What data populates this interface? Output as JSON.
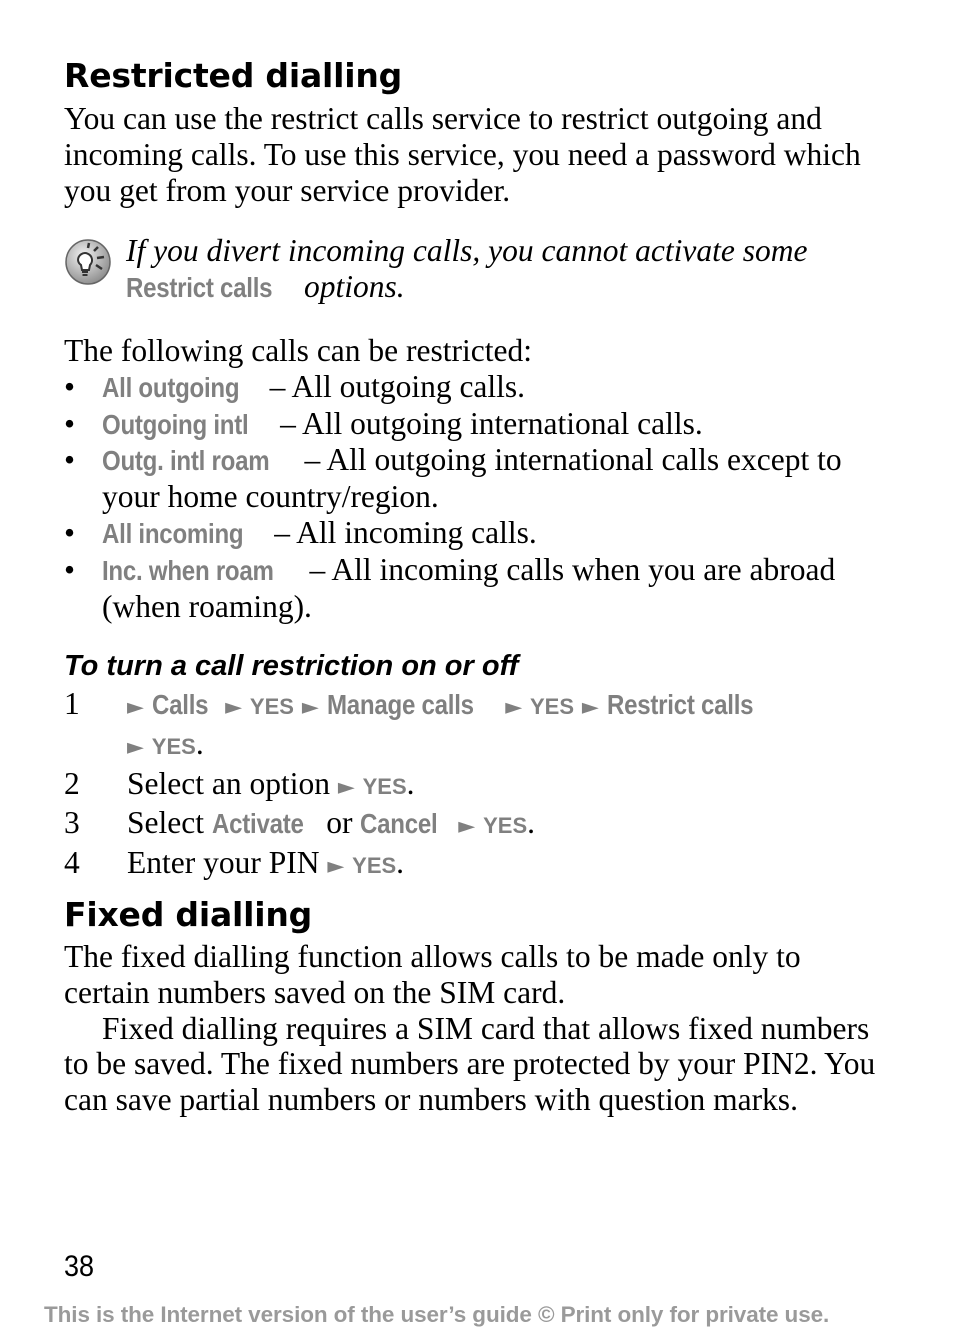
{
  "sections": {
    "restricted": {
      "title": "Restricted dialling",
      "intro": "You can use the restrict calls service to restrict outgoing and incoming calls. To use this service, you need a password which you get from your service provider.",
      "note": {
        "icon": "lightbulb-tip-icon",
        "text_before": "If you divert incoming calls, you cannot activate some",
        "ui_term": "Restrict calls",
        "text_after": "options."
      },
      "list_intro": "The following calls can be restricted:",
      "items": [
        {
          "term": "All outgoing",
          "desc": "– All outgoing calls."
        },
        {
          "term": "Outgoing intl",
          "desc": "– All outgoing international calls."
        },
        {
          "term": "Outg. intl roam",
          "desc": "– All outgoing international calls except to your home country/region."
        },
        {
          "term": "All incoming",
          "desc": "– All incoming calls."
        },
        {
          "term": "Inc. when roam",
          "desc": "– All incoming calls when you are abroad (when roaming)."
        }
      ],
      "procedure": {
        "title": "To turn a call restriction on or off",
        "steps": [
          {
            "num": "1",
            "menu1": "Calls",
            "yes1": "YES",
            "menu2": "Manage calls",
            "yes2": "YES",
            "menu3": "Restrict calls",
            "yes3": "YES"
          },
          {
            "num": "2",
            "text": "Select an option",
            "yes": "YES"
          },
          {
            "num": "3",
            "text": "Select",
            "opt1": "Activate",
            "or": "or",
            "opt2": "Cancel",
            "yes": "YES"
          },
          {
            "num": "4",
            "text": "Enter your PIN",
            "yes": "YES"
          }
        ]
      }
    },
    "fixed": {
      "title": "Fixed dialling",
      "para1": "The fixed dialling function allows calls to be made only to certain numbers saved on the SIM card.",
      "para2": "Fixed dialling requires a SIM card that allows fixed numbers to be saved. The fixed numbers are protected by your PIN2. You can save partial numbers or numbers with question marks."
    }
  },
  "glyphs": {
    "arrow": "►",
    "bullet": "•",
    "period": "."
  },
  "page_number": "38",
  "footer": "This is the Internet version of the user’s guide © Print only for private use."
}
